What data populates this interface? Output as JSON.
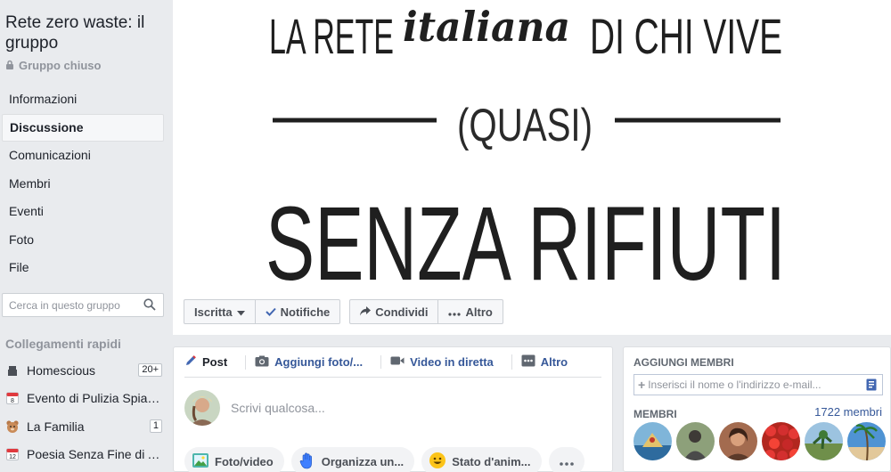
{
  "group": {
    "title": "Rete zero waste: il gruppo",
    "privacy": "Gruppo chiuso"
  },
  "nav": {
    "items": [
      {
        "label": "Informazioni"
      },
      {
        "label": "Discussione"
      },
      {
        "label": "Comunicazioni"
      },
      {
        "label": "Membri"
      },
      {
        "label": "Eventi"
      },
      {
        "label": "Foto"
      },
      {
        "label": "File"
      }
    ]
  },
  "search": {
    "placeholder": "Cerca in questo gruppo"
  },
  "quick_links": {
    "heading": "Collegamenti rapidi",
    "items": [
      {
        "label": "Homescious",
        "badge": "20+",
        "icon": "group-icon"
      },
      {
        "label": "Evento di Pulizia Spiag...",
        "badge": "",
        "icon": "calendar-icon",
        "cal_day": "8"
      },
      {
        "label": "La Familia",
        "badge": "1",
        "icon": "bear-icon"
      },
      {
        "label": "Poesia Senza Fine di A...",
        "badge": "",
        "icon": "calendar-icon",
        "cal_day": "12"
      }
    ]
  },
  "cover": {
    "line1_a": "LA RETE",
    "line1_b": "italiana",
    "line1_c": "DI CHI VIVE",
    "line2": "(QUASI)",
    "line3": "SENZA RIFIUTI",
    "buttons": {
      "joined": "Iscritta",
      "notifications": "Notifiche",
      "share": "Condividi",
      "more": "Altro"
    }
  },
  "composer": {
    "tabs": {
      "post": "Post",
      "photo": "Aggiungi foto/...",
      "live": "Video in diretta",
      "more": "Altro"
    },
    "placeholder": "Scrivi qualcosa...",
    "chips": {
      "photo_video": "Foto/video",
      "organize": "Organizza un...",
      "feeling": "Stato d'anim..."
    }
  },
  "members": {
    "add_heading": "AGGIUNGI MEMBRI",
    "add_placeholder": "Inserisci il nome o l'indirizzo e-mail...",
    "heading": "MEMBRI",
    "count": "1722 membri"
  },
  "colors": {
    "accent": "#4267b2",
    "link": "#365899",
    "background": "#e9ebee"
  }
}
